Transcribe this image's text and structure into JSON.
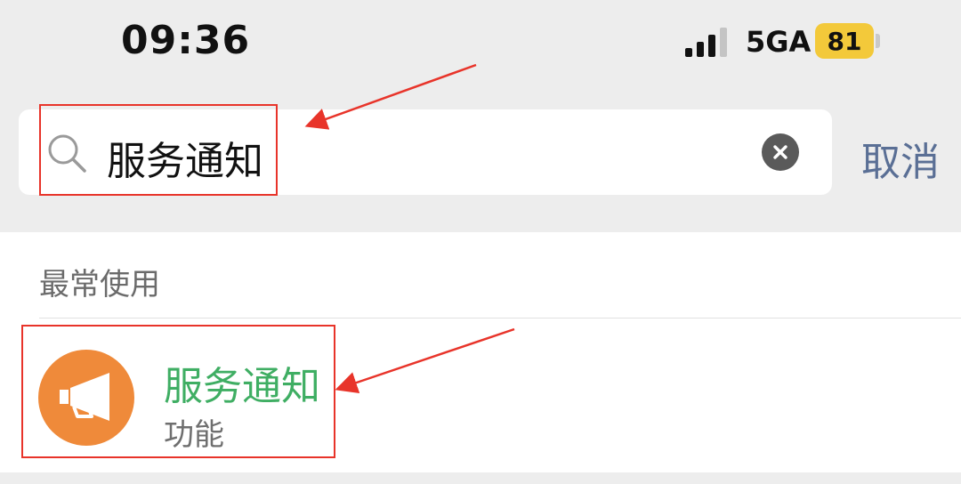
{
  "status_bar": {
    "time": "09:36",
    "network": "5GA",
    "battery": "81"
  },
  "search": {
    "query": "服务通知",
    "cancel_label": "取消"
  },
  "results": {
    "section_label": "最常使用",
    "items": [
      {
        "title": "服务通知",
        "subtitle": "功能",
        "icon": "megaphone-icon"
      }
    ]
  },
  "colors": {
    "background": "#ededed",
    "result_title": "#3fae63",
    "avatar": "#ef8a3a",
    "cancel": "#5a6f95",
    "annotation": "#e8342a",
    "battery": "#f3c93a"
  }
}
